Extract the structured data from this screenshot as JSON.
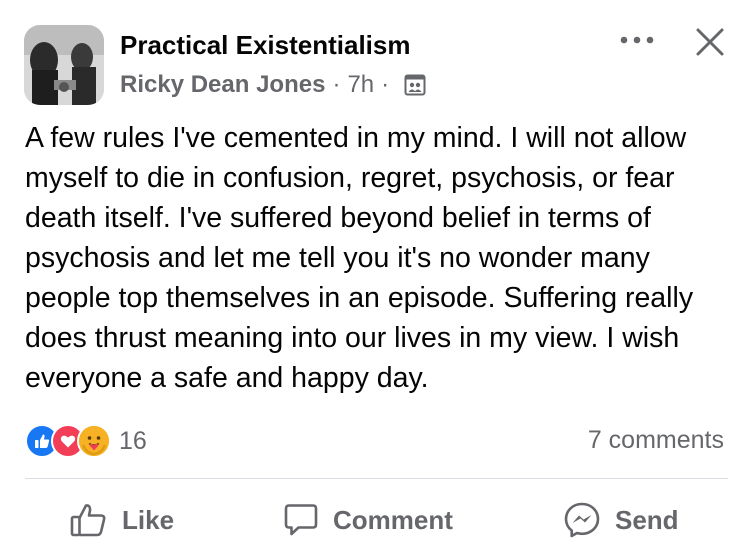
{
  "post": {
    "group_name": "Practical Existentialism",
    "author": "Ricky Dean Jones",
    "separator": "·",
    "time": "7h",
    "audience_icon": "group-privacy-icon",
    "text": "A few rules I've cemented in my mind. I will not allow myself to die in confusion, regret, psychosis, or fear death itself. I've suffered beyond belief in terms of psychosis and let me tell you it's no wonder many people top themselves in an episode. Suffering really does thrust meaning into our lives in my view. I wish everyone a safe and happy day."
  },
  "header_actions": {
    "more_icon": "more-options-icon",
    "close_icon": "close-icon"
  },
  "reactions": {
    "types": [
      "like",
      "love",
      "care"
    ],
    "count": "16",
    "colors": {
      "like": "#1877f2",
      "love": "#f33e58",
      "care": "#f7b125"
    }
  },
  "comments_label": "7 comments",
  "actions": {
    "like": "Like",
    "comment": "Comment",
    "send": "Send"
  }
}
